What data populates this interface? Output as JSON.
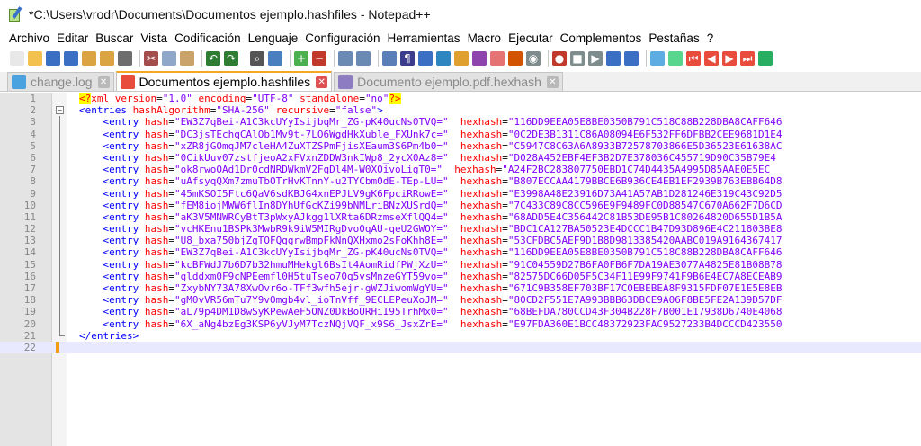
{
  "window": {
    "title": "*C:\\Users\\vrodr\\Documents\\Documentos ejemplo.hashfiles - Notepad++"
  },
  "menu": [
    "Archivo",
    "Editar",
    "Buscar",
    "Vista",
    "Codificación",
    "Lenguaje",
    "Configuración",
    "Herramientas",
    "Macro",
    "Ejecutar",
    "Complementos",
    "Pestañas",
    "?"
  ],
  "toolbar": {
    "icons": [
      {
        "name": "new-file-icon",
        "color": "#e8e8e8",
        "glyph": ""
      },
      {
        "name": "open-file-icon",
        "color": "#f2c14e",
        "glyph": ""
      },
      {
        "name": "save-icon",
        "color": "#3b6fc4",
        "glyph": ""
      },
      {
        "name": "save-all-icon",
        "color": "#3b6fc4",
        "glyph": ""
      },
      {
        "name": "close-icon",
        "color": "#d9a441",
        "glyph": ""
      },
      {
        "name": "close-all-icon",
        "color": "#d9a441",
        "glyph": ""
      },
      {
        "name": "print-icon",
        "color": "#6d6d6d",
        "glyph": ""
      },
      {
        "name": "sep"
      },
      {
        "name": "cut-icon",
        "color": "#a34d4d",
        "glyph": "✂"
      },
      {
        "name": "copy-icon",
        "color": "#8fa7c9",
        "glyph": ""
      },
      {
        "name": "paste-icon",
        "color": "#c9a36a",
        "glyph": ""
      },
      {
        "name": "sep"
      },
      {
        "name": "undo-icon",
        "color": "#2e7d32",
        "glyph": "↶"
      },
      {
        "name": "redo-icon",
        "color": "#2e7d32",
        "glyph": "↷"
      },
      {
        "name": "sep"
      },
      {
        "name": "find-icon",
        "color": "#555555",
        "glyph": "⌕"
      },
      {
        "name": "replace-icon",
        "color": "#4a7fbf",
        "glyph": ""
      },
      {
        "name": "sep"
      },
      {
        "name": "zoom-in-icon",
        "color": "#4caf50",
        "glyph": "+"
      },
      {
        "name": "zoom-out-icon",
        "color": "#c0392b",
        "glyph": "−"
      },
      {
        "name": "sep"
      },
      {
        "name": "sync-vertical-icon",
        "color": "#6a89b3",
        "glyph": ""
      },
      {
        "name": "sync-horizontal-icon",
        "color": "#6a89b3",
        "glyph": ""
      },
      {
        "name": "sep"
      },
      {
        "name": "word-wrap-icon",
        "color": "#5a7fb8",
        "glyph": ""
      },
      {
        "name": "show-all-characters-icon",
        "color": "#3c3c8c",
        "glyph": "¶"
      },
      {
        "name": "indent-guide-icon",
        "color": "#3b6fc4",
        "glyph": ""
      },
      {
        "name": "user-language-icon",
        "color": "#2e86c1",
        "glyph": ""
      },
      {
        "name": "doc-map-icon",
        "color": "#e0a030",
        "glyph": ""
      },
      {
        "name": "function-list-icon",
        "color": "#8e44ad",
        "glyph": ""
      },
      {
        "name": "folder-workspace-icon",
        "color": "#e57373",
        "glyph": ""
      },
      {
        "name": "doc-list-icon",
        "color": "#d35400",
        "glyph": ""
      },
      {
        "name": "monitoring-icon",
        "color": "#7f8c8d",
        "glyph": "◉"
      },
      {
        "name": "sep"
      },
      {
        "name": "record-macro-icon",
        "color": "#c0392b",
        "glyph": "●"
      },
      {
        "name": "stop-macro-icon",
        "color": "#7f8c8d",
        "glyph": "■"
      },
      {
        "name": "play-macro-icon",
        "color": "#7f8c8d",
        "glyph": "▶"
      },
      {
        "name": "run-macro-multiple-icon",
        "color": "#3b6fc4",
        "glyph": ""
      },
      {
        "name": "save-macro-icon",
        "color": "#3b6fc4",
        "glyph": ""
      },
      {
        "name": "sep"
      },
      {
        "name": "plugin-compare-icon",
        "color": "#5dade2",
        "glyph": ""
      },
      {
        "name": "plugin-compare-clear-icon",
        "color": "#58d68d",
        "glyph": ""
      },
      {
        "name": "plugin-first-diff-icon",
        "color": "#e74c3c",
        "glyph": "⏮"
      },
      {
        "name": "plugin-prev-diff-icon",
        "color": "#e74c3c",
        "glyph": "◀"
      },
      {
        "name": "plugin-next-diff-icon",
        "color": "#e74c3c",
        "glyph": "▶"
      },
      {
        "name": "plugin-last-diff-icon",
        "color": "#e74c3c",
        "glyph": "⏭"
      },
      {
        "name": "plugin-settings-icon",
        "color": "#27ae60",
        "glyph": ""
      }
    ]
  },
  "tabs": [
    {
      "label": "change.log",
      "active": false,
      "icon_color": "#4aa3df"
    },
    {
      "label": "Documentos ejemplo.hashfiles",
      "active": true,
      "icon_color": "#e74c3c"
    },
    {
      "label": "Documento ejemplo.pdf.hexhash",
      "active": false,
      "icon_color": "#8e7cc3"
    }
  ],
  "editor": {
    "current_line": 22,
    "lines": [
      {
        "n": "1",
        "kind": "pi",
        "text": "<?xml version=\"1.0\" encoding=\"UTF-8\" standalone=\"no\"?>"
      },
      {
        "n": "2",
        "kind": "open",
        "text": "<entries hashAlgorithm=\"SHA-256\" recursive=\"false\">"
      },
      {
        "n": "3",
        "kind": "entry",
        "hash": "EW3Z7qBei-A1C3kcUYyIsijbqMr_ZG-pK40ucNs0TVQ=",
        "hexhash": "116DD9EEA05E8BE0350B791C518C88B228DBA8CAFF646"
      },
      {
        "n": "4",
        "kind": "entry",
        "hash": "DC3jsTEchqCAlOb1Mv9t-7LO6WgdHkXuble_FXUnk7c=",
        "hexhash": "0C2DE3B1311C86A08094E6F532FF6DFBB2CEE9681D1E4"
      },
      {
        "n": "5",
        "kind": "entry",
        "hash": "xZR8jGOmqJM7cleHA4ZuXTZSPmFjisXEaum3S6Pm4b0=",
        "hexhash": "C5947C8C63A6A8933B7257870386 6E5D36523E61638AC"
      },
      {
        "n": "6",
        "kind": "entry",
        "hash": "0CikUuv07zstfjeoA2xFVxnZDDW3nkIWp8_2ycX0Az8=",
        "hexhash": "D028A452EBF4EF3B2D7E378036C455719D90C35B79E4"
      },
      {
        "n": "7",
        "kind": "entry",
        "hash": "ok8rwoOAd1Dr0cdNRDWkmV2FqDl4M-W0XOivoLigT0=",
        "hexhash": "A24F2BC283807750EBD1C74D4435A4995D85AAE0E5EC"
      },
      {
        "n": "8",
        "kind": "entry",
        "hash": "uAfsyqQXm7zmuTbOTrHvKTnnY-u2TYCbm0dE-TEp-LU=",
        "hexhash": "B807ECCAA4179BBCE6B936CE4EB1EF2939B763EBB64D8"
      },
      {
        "n": "9",
        "kind": "entry",
        "hash": "45mKSOI5Ftc6QaV6sdKBJG4xnEPJLV9gK6FpciRRowE=",
        "hexhash": "E3998A48E23916D73A41A57AB1D281246E319C43C92D5"
      },
      {
        "n": "10",
        "kind": "entry",
        "hash": "fEM8iojMWW6flIn8DYhUfGcKZi99bNMLriBNzXUSrdQ=",
        "hexhash": "7C433C89C8CC596E9F9489FC0D88547C670A662F7D6CD"
      },
      {
        "n": "11",
        "kind": "entry",
        "hash": "aK3V5MNWRCyBtT3pWxyAJkgg1lXRta6DRzmseXflQQ4=",
        "hexhash": "68ADD5E4C356442C81B53DE95B1C80264820D655D1B5A"
      },
      {
        "n": "12",
        "kind": "entry",
        "hash": "vcHKEnu1BSPk3MwbR9k9iW5MIRgDvo0qAU-qeU2GWOY=",
        "hexhash": "BDC1CA127BA50523E4DCCC1B47D93D896E4C211803BE8"
      },
      {
        "n": "13",
        "kind": "entry",
        "hash": "U8_bxa750bjZgTOFQggrwBmpFkNnQXHxmo2sFoKhh8E=",
        "hexhash": "53CFDBC5AEF9D1B8D9813385420AABC019A9164367417"
      },
      {
        "n": "14",
        "kind": "entry",
        "hash": "EW3Z7qBei-A1C3kcUYyIsijbqMr_ZG-pK40ucNs0TVQ=",
        "hexhash": "116DD9EEA05E8BE0350B791C518C88B228DBA8CAFF646"
      },
      {
        "n": "15",
        "kind": "entry",
        "hash": "kcBFWdJ7b6D7b32hmuMHekgl6BsIt4AomRidfPWjXzU=",
        "hexhash": "91C04559D27B6FA0FB6F7DA19AE3077A4825E81B08B78"
      },
      {
        "n": "16",
        "kind": "entry",
        "hash": "glddxm0F9cNPEemfl0H5tuTseo70q5vsMnzeGYT59vo=",
        "hexhash": "82575DC66D05F5C34F11E99F9741F9B6E4EC7A8ECEAB9"
      },
      {
        "n": "17",
        "kind": "entry",
        "hash": "ZxybNY73A78XwOvr6o-TFf3wfh5ejr-gWZJiwomWgYU=",
        "hexhash": "671C9B358EF703BF17C0EBEBEA8F9315FDF07E1E5E8EB"
      },
      {
        "n": "18",
        "kind": "entry",
        "hash": "gM0vVR56mTu7Y9vOmgb4vl_ioTnVff_9ECLEPeuXoJM=",
        "hexhash": "80CD2F551E7A993BBB63DBCE9A06F8BE5FE2A139D57DF"
      },
      {
        "n": "19",
        "kind": "entry",
        "hash": "aL79p4DM1D8wSyKPewAeF5ONZ0DkBoURHiI95TrhMx0=",
        "hexhash": "68BEFDA780CCD43F304B228F7B001E17938D6740E4068"
      },
      {
        "n": "20",
        "kind": "entry",
        "hash": "6X_aNg4bzEg3KSP6yVJyM7TczNQjVQF_x9S6_JsxZrE=",
        "hexhash": "E97FDA360E1BCC48372923FAC9527233B4DCCCD423550"
      },
      {
        "n": "21",
        "kind": "close",
        "text": "</entries>"
      },
      {
        "n": "22",
        "kind": "empty",
        "text": ""
      }
    ]
  }
}
